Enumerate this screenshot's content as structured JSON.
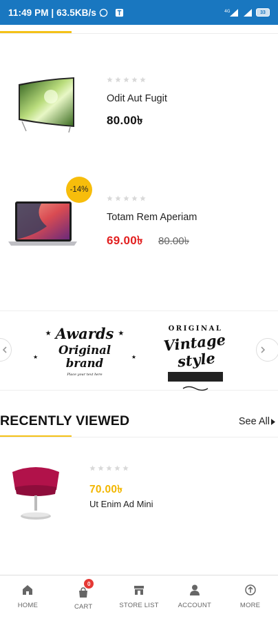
{
  "status_bar": {
    "time_speed": "11:49 PM | 63.5KB/s",
    "battery": "33"
  },
  "products": [
    {
      "name": "Odit Aut Fugit",
      "price": "80.00৳",
      "rating": 0
    },
    {
      "name": "Totam Rem Aperiam",
      "price": "69.00৳",
      "old_price": "80.00৳",
      "discount_badge": "-14%",
      "rating": 0
    }
  ],
  "brands": [
    {
      "line1": "Awards",
      "line2": "Original brand",
      "tagline": "Place your text here"
    },
    {
      "top": "ORIGINAL",
      "main": "Vintage style"
    }
  ],
  "recently_viewed": {
    "title": "RECENTLY VIEWED",
    "see_all": "See All",
    "items": [
      {
        "price": "70.00৳",
        "name": "Ut Enim Ad Mini",
        "rating": 0
      }
    ]
  },
  "bottom_nav": {
    "items": [
      {
        "label": "HOME",
        "icon": "home-icon"
      },
      {
        "label": "CART",
        "icon": "cart-icon",
        "badge": "0"
      },
      {
        "label": "STORE LIST",
        "icon": "store-icon"
      },
      {
        "label": "ACCOUNT",
        "icon": "account-icon"
      },
      {
        "label": "MORE",
        "icon": "more-icon"
      }
    ]
  },
  "colors": {
    "status_bar": "#1977c0",
    "accent": "#f4c117",
    "sale_price": "#e22020",
    "badge": "#f7bd0b"
  }
}
